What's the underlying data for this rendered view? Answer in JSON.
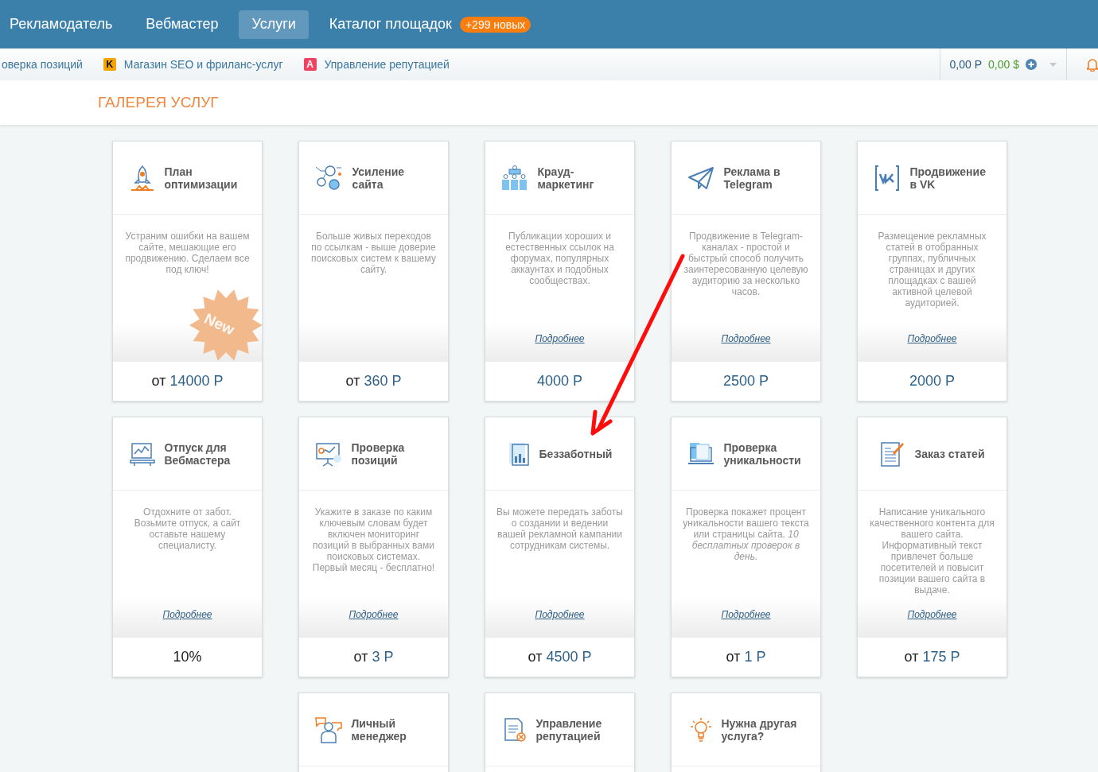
{
  "top_nav": {
    "items": [
      {
        "label": "Рекламодатель",
        "selected": false
      },
      {
        "label": "Вебмастер",
        "selected": false
      },
      {
        "label": "Услуги",
        "selected": true
      },
      {
        "label": "Каталог площадок",
        "selected": false,
        "badge": "+299 новых"
      }
    ]
  },
  "sub_nav": {
    "items": [
      {
        "label": "оверка позиций"
      },
      {
        "label": "Магазин SEO и фриланс-услуг",
        "icon_letter": "K",
        "color": "#f5a300"
      },
      {
        "label": "Управление репутацией",
        "icon_letter": "A",
        "color": "#f0435f"
      }
    ],
    "balance_rub": "0,00 Р",
    "balance_usd": "0,00 $"
  },
  "page_title": "ГАЛЕРЕЯ УСЛУГ",
  "rows": [
    [
      {
        "title": "План оптимизации",
        "description": "Устраним ошибки на вашем сайте, мешающие его продвижению. Сделаем все под ключ!",
        "badge": "New",
        "price": {
          "prefix": "от",
          "amount": "14000 Р"
        }
      },
      {
        "title": "Усиление сайта",
        "description": "Больше живых переходов по ссылкам - выше доверие поисковых систем к вашему сайту.",
        "price": {
          "prefix": "от",
          "amount": "360 Р"
        }
      },
      {
        "title": "Крауд-маркетинг",
        "description": "Публикации хороших и естественных ссылок на форумах, популярных аккаунтах и подобных сообществах.",
        "link": "Подробнее",
        "price": {
          "amount": "4000 Р"
        }
      },
      {
        "title": "Реклама в Telegram",
        "description": "Продвижение в Telegram-каналах - простой и быстрый способ получить заинтересованную целевую аудиторию за несколько часов.",
        "link": "Подробнее",
        "price": {
          "amount": "2500 Р"
        }
      },
      {
        "title": "Продвижение в VK",
        "description": "Размещение рекламных статей в отобранных группах, публичных страницах и других площадках с вашей активной целевой аудиторией.",
        "link": "Подробнее",
        "price": {
          "amount": "2000 Р"
        }
      }
    ],
    [
      {
        "title": "Отпуск для Вебмастера",
        "description": "Отдохните от забот. Возьмите отпуск, а сайт оставьте нашему специалисту.",
        "link": "Подробнее",
        "price": {
          "discount": "10%"
        }
      },
      {
        "title": "Проверка позиций",
        "description": "Укажите в заказе по каким ключевым словам будет включен мониторинг позиций в выбранных вами поисковых системах. Первый месяц - бесплатно!",
        "link": "Подробнее",
        "price": {
          "prefix": "от",
          "amount": "3 Р"
        }
      },
      {
        "title": "Беззаботный",
        "description": "Вы можете передать заботы о создании и ведении вашей рекламной кампании сотрудникам системы.",
        "link": "Подробнее",
        "price": {
          "prefix": "от",
          "amount": "4500 Р"
        }
      },
      {
        "title": "Проверка уникальности",
        "description": "Проверка покажет процент уникальности вашего текста или страницы сайта. *10 бесплатных проверок в день.*",
        "link": "Подробнее",
        "price": {
          "prefix": "от",
          "amount": "1 Р"
        }
      },
      {
        "title": "Заказ статей",
        "description": "Написание уникального качественного контента для вашего сайта. Информативный текст привлечет больше посетителей и повысит позиции вашего сайта в выдаче.",
        "link": "Подробнее",
        "price": {
          "prefix": "от",
          "amount": "175 Р"
        }
      }
    ],
    [
      {
        "title": "Личный менеджер"
      },
      {
        "title": "Управление репутацией"
      },
      {
        "title": "Нужна другая услуга?"
      }
    ]
  ]
}
